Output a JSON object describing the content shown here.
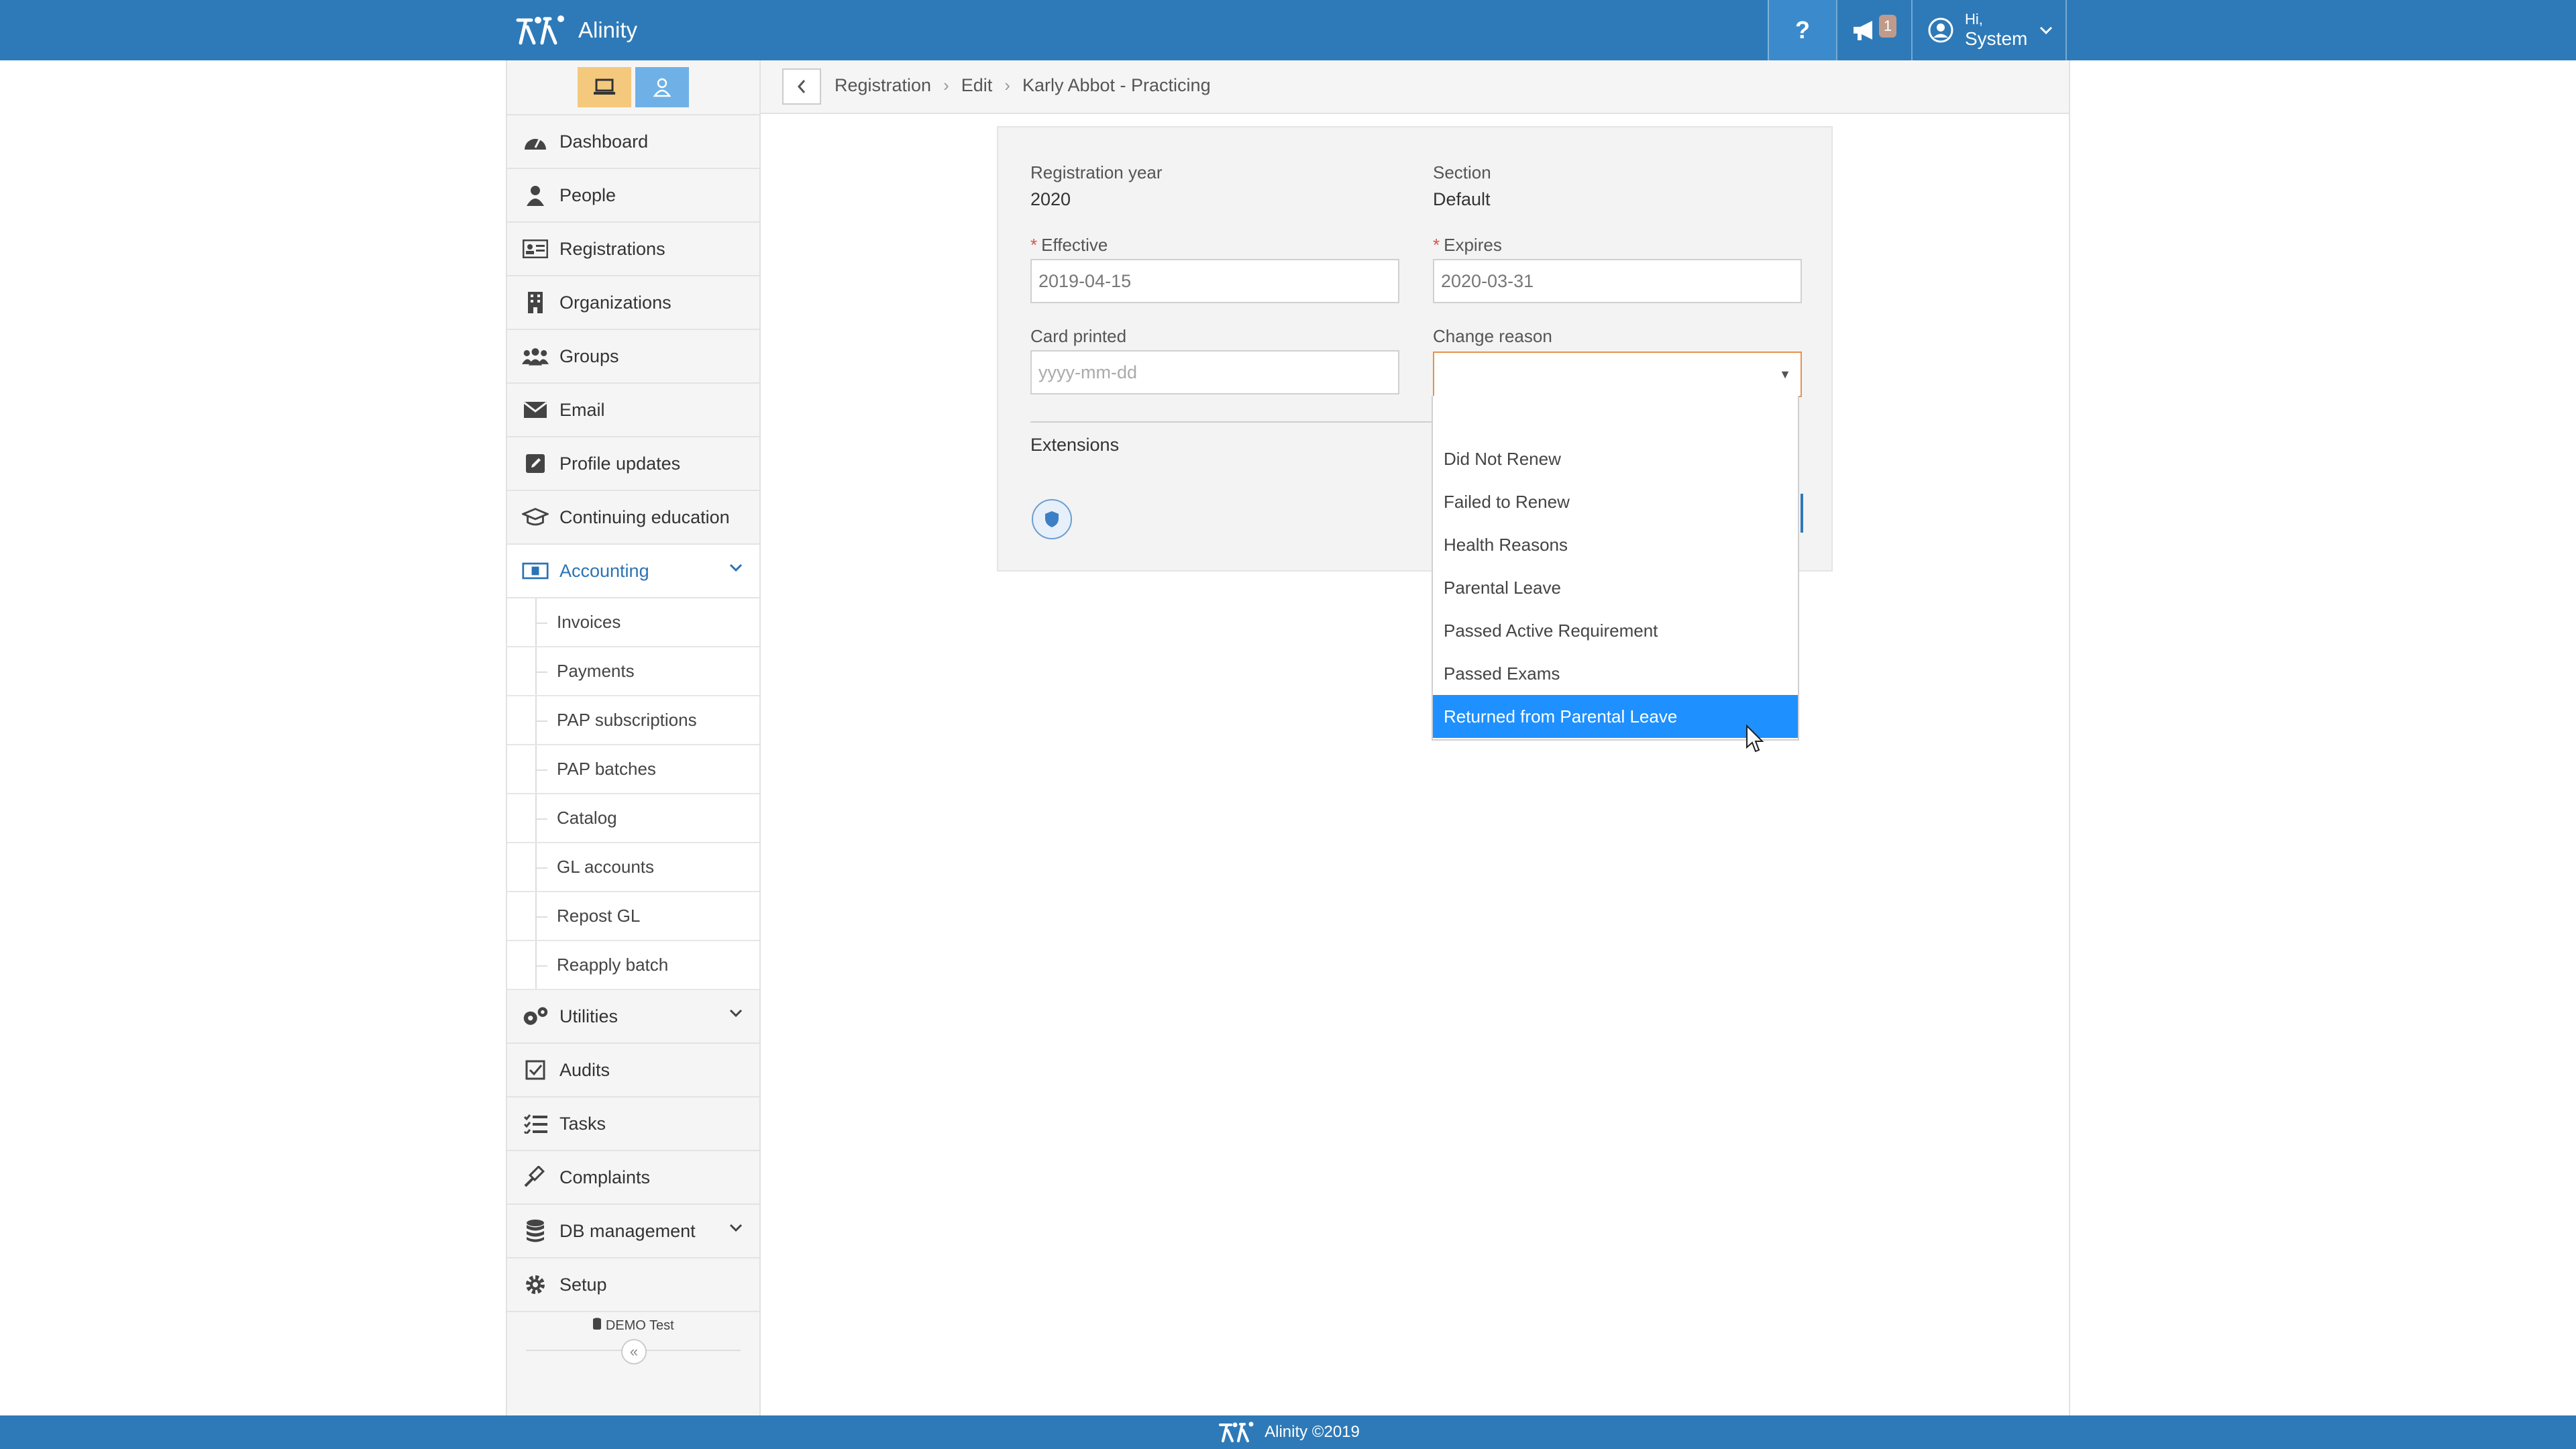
{
  "app": {
    "name": "Alinity"
  },
  "header": {
    "help_label": "?",
    "notification_count": "1",
    "user_greeting": "Hi,",
    "user_name": "System"
  },
  "sidebar": {
    "items": [
      {
        "label": "Dashboard",
        "icon": "dashboard-icon"
      },
      {
        "label": "People",
        "icon": "person-icon"
      },
      {
        "label": "Registrations",
        "icon": "id-card-icon"
      },
      {
        "label": "Organizations",
        "icon": "building-icon"
      },
      {
        "label": "Groups",
        "icon": "users-icon"
      },
      {
        "label": "Email",
        "icon": "envelope-icon"
      },
      {
        "label": "Profile updates",
        "icon": "edit-icon"
      },
      {
        "label": "Continuing education",
        "icon": "graduation-cap-icon"
      },
      {
        "label": "Accounting",
        "icon": "money-icon"
      }
    ],
    "accounting_sub": [
      "Invoices",
      "Payments",
      "PAP subscriptions",
      "PAP batches",
      "Catalog",
      "GL accounts",
      "Repost GL",
      "Reapply batch"
    ],
    "items_after": [
      {
        "label": "Utilities",
        "icon": "cogs-icon"
      },
      {
        "label": "Audits",
        "icon": "check-square-icon"
      },
      {
        "label": "Tasks",
        "icon": "tasks-icon"
      },
      {
        "label": "Complaints",
        "icon": "gavel-icon"
      },
      {
        "label": "DB management",
        "icon": "database-icon"
      },
      {
        "label": "Setup",
        "icon": "gear-icon"
      }
    ],
    "db_label": "DEMO Test",
    "collapse_label": "«"
  },
  "breadcrumb": [
    "Registration",
    "Edit",
    "Karly Abbot - Practicing"
  ],
  "form": {
    "registration_year_label": "Registration year",
    "registration_year_value": "2020",
    "section_label": "Section",
    "section_value": "Default",
    "effective_label": "Effective",
    "effective_value": "2019-04-15",
    "expires_label": "Expires",
    "expires_value": "2020-03-31",
    "card_printed_label": "Card printed",
    "card_printed_placeholder": "yyyy-mm-dd",
    "change_reason_label": "Change reason",
    "change_reason_value": "",
    "extensions_label": "Extensions",
    "required_mark": "*"
  },
  "dropdown": {
    "options": [
      "",
      "Did Not Renew",
      "Failed to Renew",
      "Health Reasons",
      "Parental Leave",
      "Passed Active Requirement",
      "Passed Exams",
      "Returned from Parental Leave"
    ],
    "highlighted": "Returned from Parental Leave"
  },
  "footer": {
    "text": "Alinity ©2019"
  },
  "colors": {
    "brand": "#2e7ab8",
    "accent": "#2b73b5",
    "highlight": "#1e90ff",
    "focus_border": "#e8914e"
  }
}
